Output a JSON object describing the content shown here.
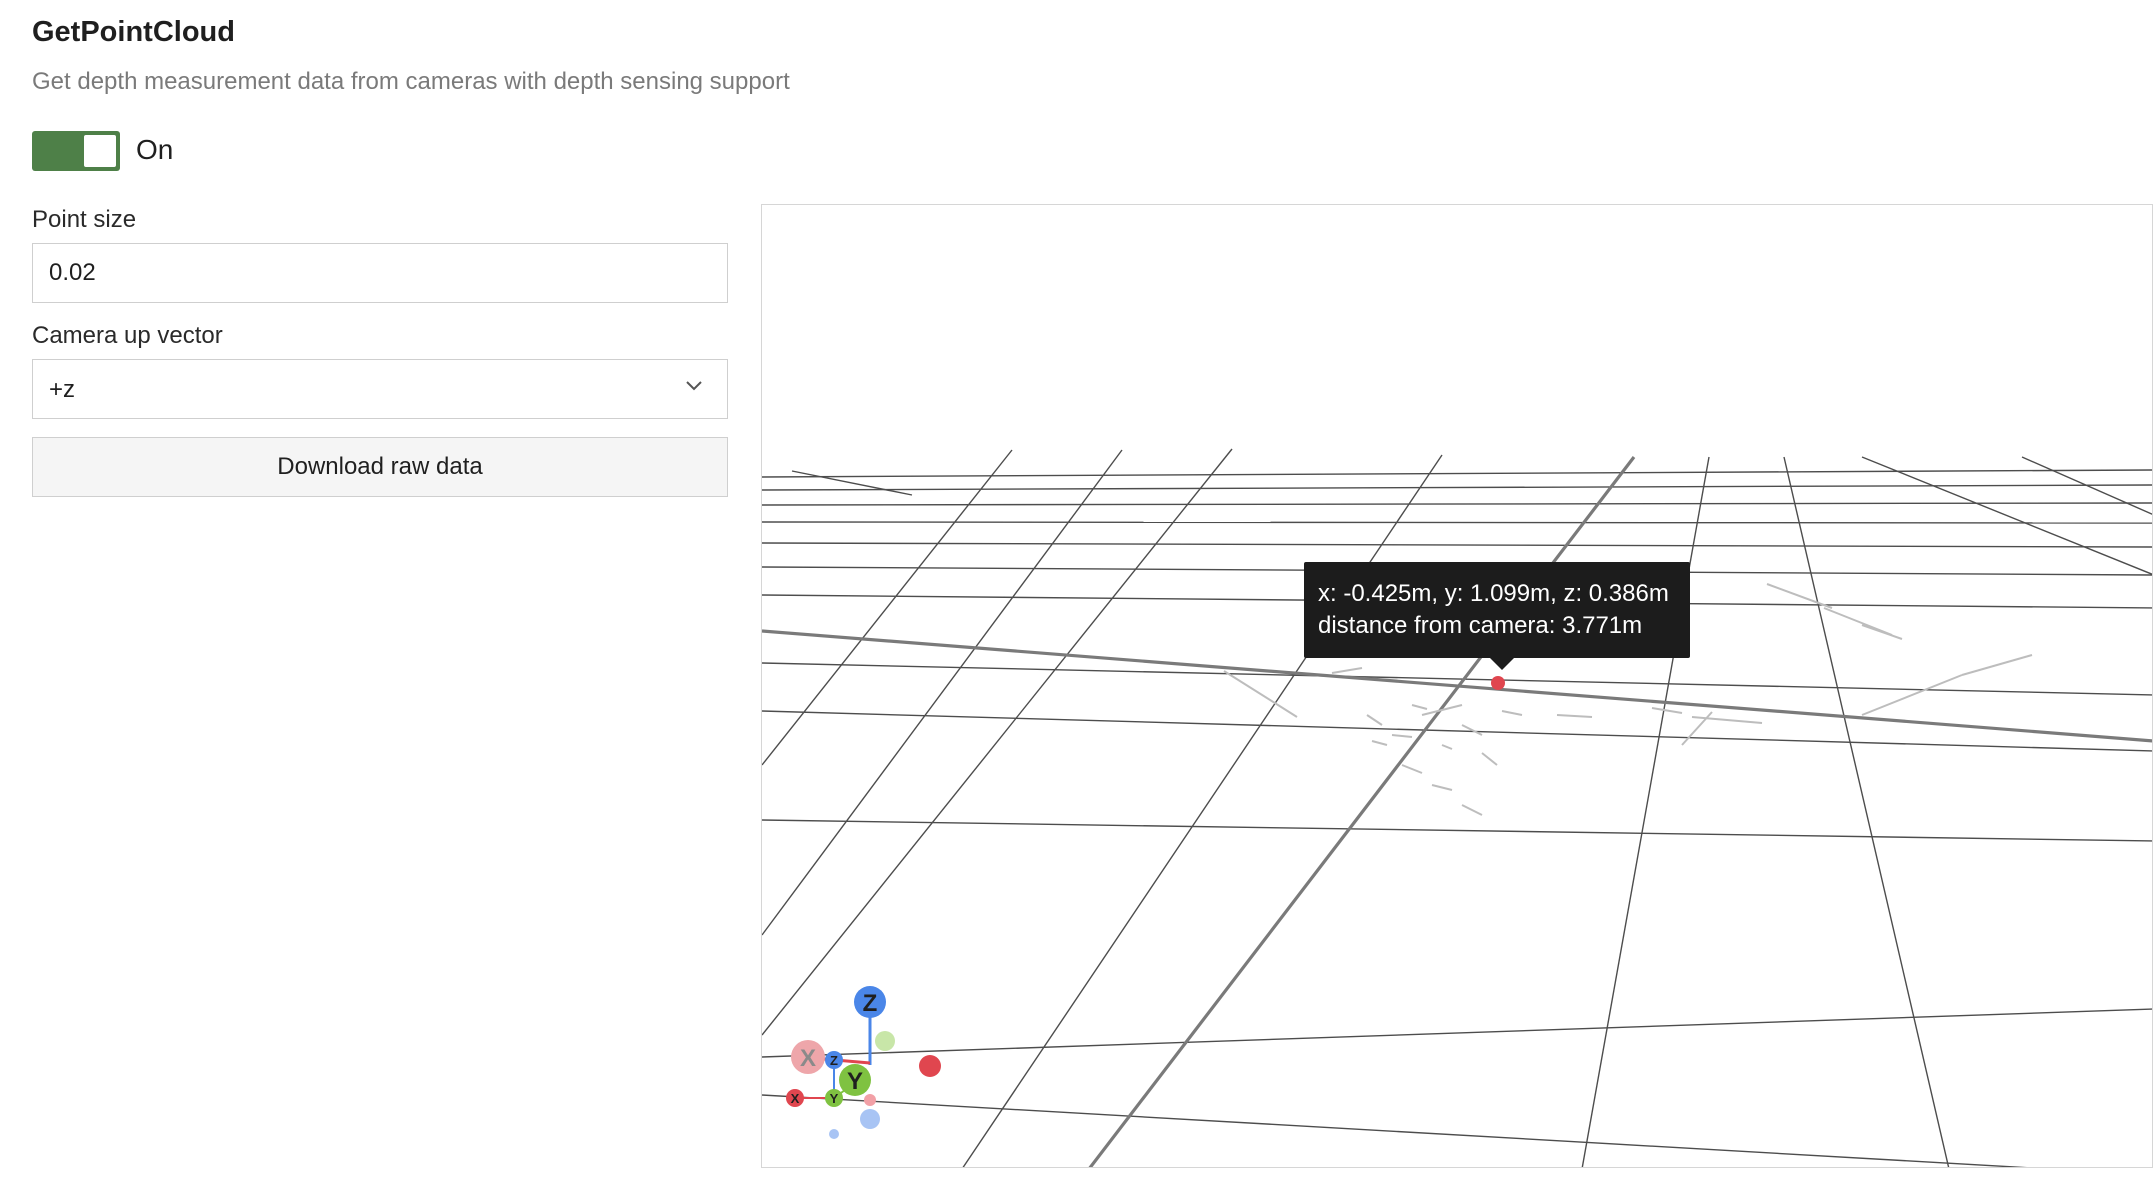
{
  "header": {
    "title": "GetPointCloud",
    "subtitle": "Get depth measurement data from cameras with depth sensing support"
  },
  "toggle": {
    "state_label": "On",
    "enabled": true
  },
  "point_size": {
    "label": "Point size",
    "value": "0.02"
  },
  "camera_up": {
    "label": "Camera up vector",
    "selected": "+z"
  },
  "download": {
    "label": "Download raw data"
  },
  "viewer": {
    "tooltip": {
      "coords": "x: -0.425m, y: 1.099m, z: 0.386m",
      "distance": "distance from camera: 3.771m"
    },
    "gizmo": {
      "z": "Z",
      "y": "Y",
      "x": "X"
    },
    "colors": {
      "x_axis": "#e0464f",
      "y_axis": "#7fc241",
      "z_axis": "#4a86e8",
      "point": "#e0464f",
      "accent": "#4e8048"
    }
  }
}
